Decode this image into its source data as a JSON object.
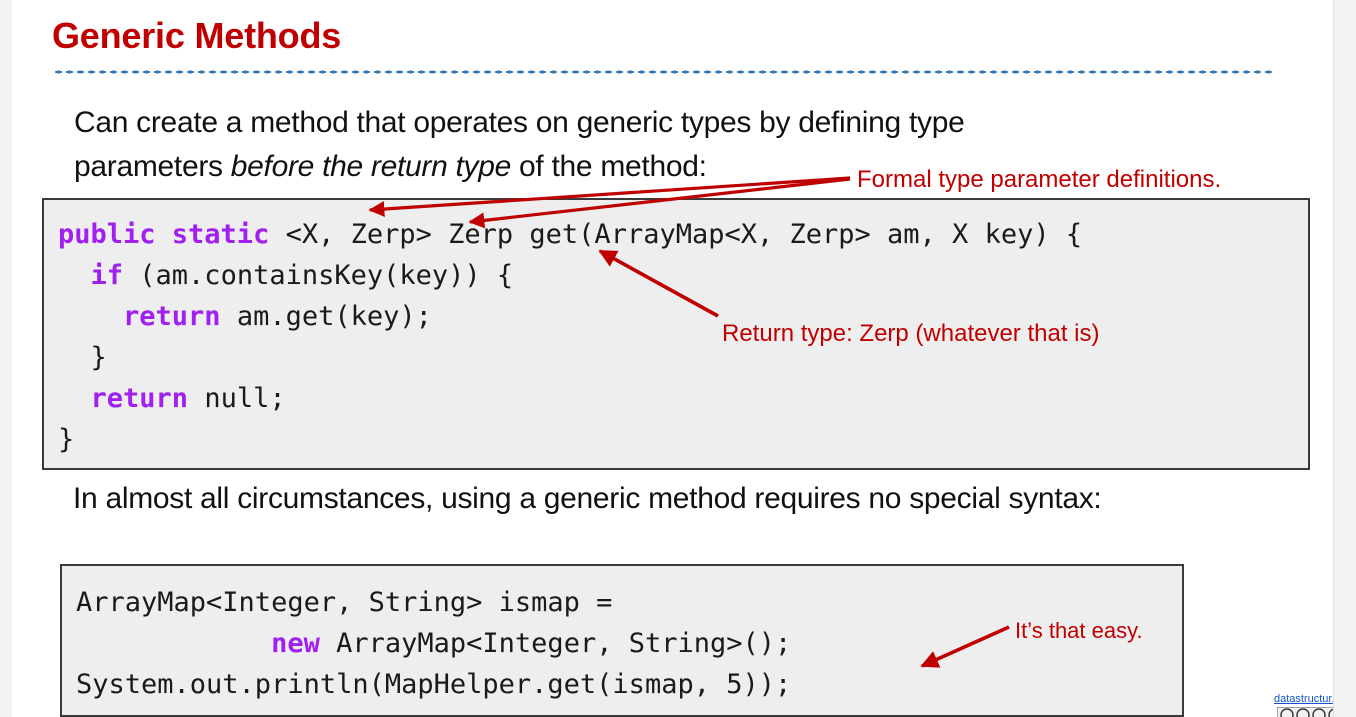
{
  "slide": {
    "title": "Generic Methods",
    "title_color": "#C00000",
    "rule_color": "#2E75B6",
    "background": "#FFFFFF"
  },
  "body": {
    "intro_line1": "Can create a method that operates on generic types by defining type",
    "intro_line2_a": "parameters ",
    "intro_line2_em": "before the return type",
    "intro_line2_b": " of the method:",
    "middle": "In almost all circumstances, using a generic method requires no special syntax:"
  },
  "code_block_1": {
    "background": "#EEEEEE",
    "border_color": "#3A3A3A",
    "keyword_color": "#A020F0",
    "lines": [
      {
        "segments": [
          {
            "text": "public static",
            "kind": "keyword"
          },
          {
            "text": " <X, Zerp> Zerp get(ArrayMap<X, Zerp> am, X key) {",
            "kind": "plain"
          }
        ]
      },
      {
        "segments": [
          {
            "text": "  ",
            "kind": "plain"
          },
          {
            "text": "if",
            "kind": "keyword"
          },
          {
            "text": " (am.containsKey(key)) {",
            "kind": "plain"
          }
        ]
      },
      {
        "segments": [
          {
            "text": "    ",
            "kind": "plain"
          },
          {
            "text": "return",
            "kind": "keyword"
          },
          {
            "text": " am.get(key);",
            "kind": "plain"
          }
        ]
      },
      {
        "segments": [
          {
            "text": "  }",
            "kind": "plain"
          }
        ]
      },
      {
        "segments": [
          {
            "text": "  ",
            "kind": "plain"
          },
          {
            "text": "return",
            "kind": "keyword"
          },
          {
            "text": " null;",
            "kind": "plain"
          }
        ]
      },
      {
        "segments": [
          {
            "text": "}",
            "kind": "plain"
          }
        ]
      }
    ]
  },
  "code_block_2": {
    "background": "#EEEEEE",
    "border_color": "#3A3A3A",
    "keyword_color": "#A020F0",
    "lines": [
      {
        "segments": [
          {
            "text": "ArrayMap<Integer, String> ismap =",
            "kind": "plain"
          }
        ]
      },
      {
        "segments": [
          {
            "text": "            ",
            "kind": "plain"
          },
          {
            "text": "new",
            "kind": "keyword"
          },
          {
            "text": " ArrayMap<Integer, String>();",
            "kind": "plain"
          }
        ]
      },
      {
        "segments": [
          {
            "text": "System.out.println(MapHelper.get(ismap, 5));",
            "kind": "plain"
          }
        ]
      }
    ]
  },
  "annotations": {
    "color": "#C00000",
    "formal": "Formal type parameter definitions.",
    "return_type": "Return type: Zerp (whatever that is)",
    "easy": "It’s that easy."
  },
  "footer": {
    "link_text": "datastructur.es",
    "link_color": "#1155CC",
    "license_badge": "creative-commons-by-nc-sa"
  }
}
